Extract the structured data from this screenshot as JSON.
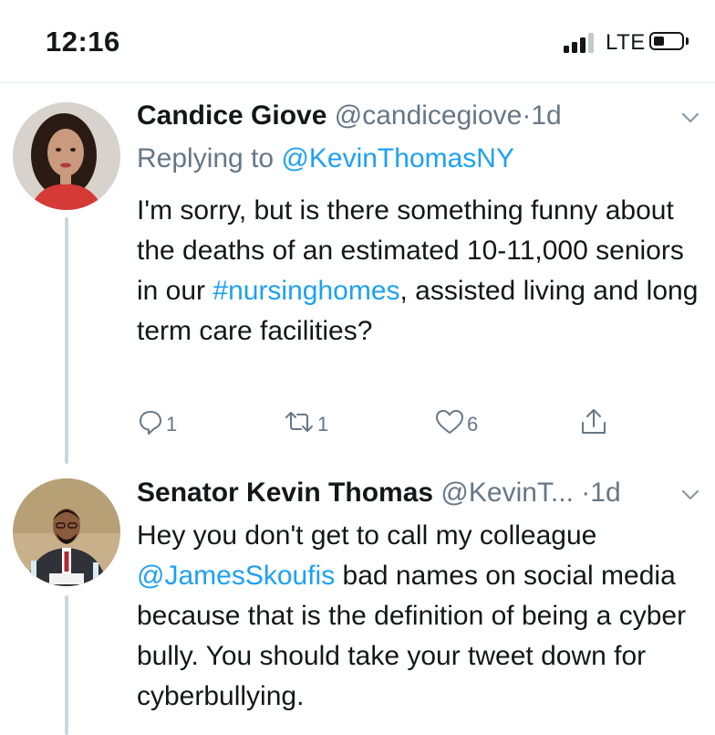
{
  "status_bar": {
    "time": "12:16",
    "network": "LTE"
  },
  "tweets": [
    {
      "display_name": "Candice Giove",
      "handle": "@candicegiove",
      "separator": "·",
      "time": "1d",
      "replying_prefix": "Replying to ",
      "replying_handle": "@KevinThomasNY",
      "body_before_link": "I'm sorry, but is there something funny about the deaths of an estimated 10-11,000 seniors in our ",
      "body_link": "#nursinghomes",
      "body_after_link": ", assisted living and long term care facilities?",
      "reply_count": "1",
      "retweet_count": "1",
      "like_count": "6"
    },
    {
      "display_name": "Senator Kevin Thomas",
      "handle": "@KevinT...",
      "separator": "·",
      "time": "1d",
      "body_before_link": "Hey you don't get to call my colleague ",
      "body_link": "@JamesSkoufis",
      "body_after_link": " bad names on social media because that is the definition of being a cyber bully. You should take your tweet down for cyberbullying."
    }
  ],
  "icons": {
    "status": [
      "signal-icon",
      "battery-icon"
    ],
    "tweet_actions": [
      "reply-icon",
      "retweet-icon",
      "like-icon",
      "share-icon"
    ],
    "menu": "chevron-down-icon"
  },
  "colors": {
    "link": "#1da1f2",
    "secondary_text": "#657786",
    "primary_text": "#14171a",
    "thread_line": "#ccd6dd"
  }
}
